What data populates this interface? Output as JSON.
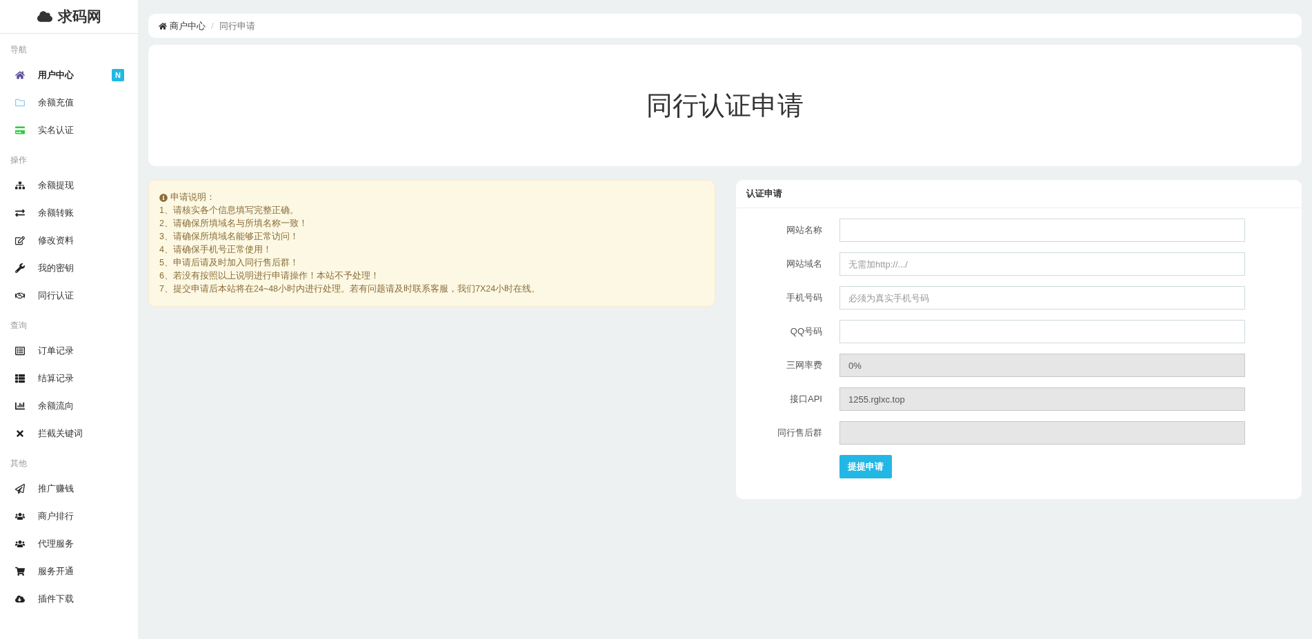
{
  "brand": {
    "name": "求码网"
  },
  "sidebar": {
    "sections": [
      {
        "heading": "导航",
        "items": [
          {
            "label": "用户中心",
            "selected": true,
            "badge": "N"
          },
          {
            "label": "余额充值",
            "selected": false
          },
          {
            "label": "实名认证",
            "selected": false
          }
        ]
      },
      {
        "heading": "操作",
        "items": [
          {
            "label": "余额提现",
            "selected": false
          },
          {
            "label": "余额转账",
            "selected": false
          },
          {
            "label": "修改资料",
            "selected": false
          },
          {
            "label": "我的密钥",
            "selected": false
          },
          {
            "label": "同行认证",
            "selected": false
          }
        ]
      },
      {
        "heading": "查询",
        "items": [
          {
            "label": "订单记录",
            "selected": false
          },
          {
            "label": "结算记录",
            "selected": false
          },
          {
            "label": "余额流向",
            "selected": false
          },
          {
            "label": "拦截关键词",
            "selected": false
          }
        ]
      },
      {
        "heading": "其他",
        "items": [
          {
            "label": "推广赚钱",
            "selected": false
          },
          {
            "label": "商户排行",
            "selected": false
          },
          {
            "label": "代理服务",
            "selected": false
          },
          {
            "label": "服务开通",
            "selected": false
          },
          {
            "label": "插件下载",
            "selected": false
          }
        ]
      }
    ]
  },
  "breadcrumb": {
    "items": [
      "商户中心",
      "同行申请"
    ],
    "separator": "/"
  },
  "page_title": "同行认证申请",
  "notice": {
    "title": "申请说明：",
    "lines": [
      "1、请核实各个信息填写完整正确。",
      "2、请确保所填域名与所填名称一致！",
      "3、请确保所填域名能够正常访问！",
      "4、请确保手机号正常使用！",
      "5、申请后请及时加入同行售后群！",
      "6、若没有按照以上说明进行申请操作！本站不予处理！",
      "7、提交申请后本站将在24~48小时内进行处理。若有问题请及时联系客服，我们7X24小时在线。"
    ]
  },
  "form": {
    "title": "认证申请",
    "fields": [
      {
        "label": "网站名称",
        "readonly": false
      },
      {
        "label": "网站域名",
        "readonly": false,
        "placeholder": "无需加http://.../"
      },
      {
        "label": "手机号码",
        "readonly": false,
        "placeholder": "必须为真实手机号码"
      },
      {
        "label": "QQ号码",
        "readonly": false
      },
      {
        "label": "三网率费",
        "readonly": true,
        "value": "0%"
      },
      {
        "label": "接口API",
        "readonly": true,
        "value": "1255.rglxc.top"
      },
      {
        "label": "同行售后群",
        "readonly": true
      }
    ],
    "submit": "提提申请"
  }
}
